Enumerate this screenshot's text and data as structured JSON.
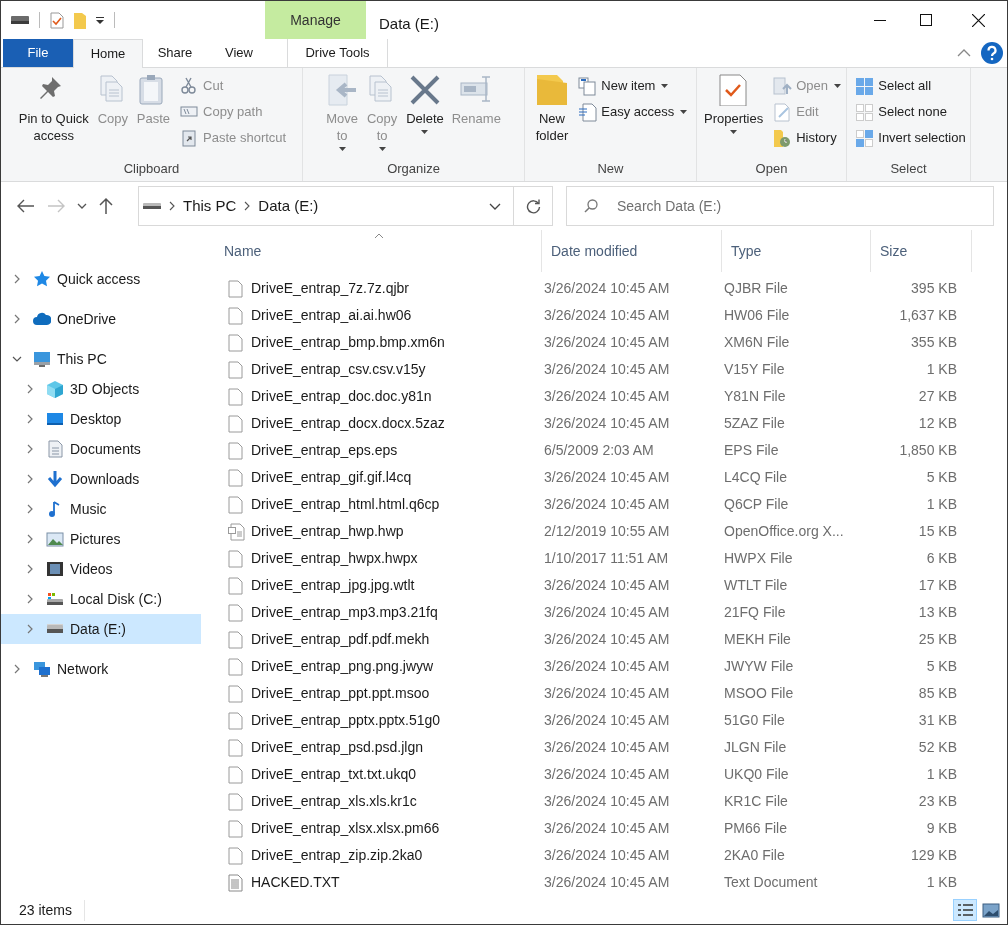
{
  "window": {
    "title": "Data (E:)"
  },
  "context_tab_group": "Manage",
  "tabs": [
    {
      "label": "File",
      "kind": "file",
      "selected": false
    },
    {
      "label": "Home",
      "kind": "tab",
      "selected": true
    },
    {
      "label": "Share",
      "kind": "tab",
      "selected": false
    },
    {
      "label": "View",
      "kind": "tab",
      "selected": false
    },
    {
      "label": "Drive Tools",
      "kind": "context",
      "selected": false
    }
  ],
  "ribbon": [
    {
      "label": "Clipboard",
      "items": [
        {
          "kind": "large",
          "label": "Pin to Quick access",
          "disabled": false,
          "dropdown": false
        },
        {
          "kind": "large",
          "label": "Copy",
          "disabled": true,
          "dropdown": false
        },
        {
          "kind": "large",
          "label": "Paste",
          "disabled": true,
          "dropdown": false
        },
        {
          "kind": "stack",
          "items": [
            {
              "label": "Cut",
              "disabled": true,
              "dropdown": false
            },
            {
              "label": "Copy path",
              "disabled": true,
              "dropdown": false
            },
            {
              "label": "Paste shortcut",
              "disabled": true,
              "dropdown": false
            }
          ]
        }
      ]
    },
    {
      "label": "Organize",
      "items": [
        {
          "kind": "large",
          "label": "Move to",
          "disabled": true,
          "dropdown": true
        },
        {
          "kind": "large",
          "label": "Copy to",
          "disabled": true,
          "dropdown": true
        },
        {
          "kind": "large",
          "label": "Delete",
          "disabled": false,
          "dropdown": true
        },
        {
          "kind": "large",
          "label": "Rename",
          "disabled": true,
          "dropdown": false
        }
      ]
    },
    {
      "label": "New",
      "items": [
        {
          "kind": "large",
          "label": "New folder",
          "disabled": false,
          "dropdown": false
        },
        {
          "kind": "stack",
          "items": [
            {
              "label": "New item",
              "disabled": false,
              "dropdown": true
            },
            {
              "label": "Easy access",
              "disabled": false,
              "dropdown": true
            }
          ]
        }
      ]
    },
    {
      "label": "Open",
      "items": [
        {
          "kind": "large",
          "label": "Properties",
          "disabled": false,
          "dropdown": true
        },
        {
          "kind": "stack",
          "items": [
            {
              "label": "Open",
              "disabled": true,
              "dropdown": true
            },
            {
              "label": "Edit",
              "disabled": true,
              "dropdown": false
            },
            {
              "label": "History",
              "disabled": false,
              "dropdown": false
            }
          ]
        }
      ]
    },
    {
      "label": "Select",
      "items": [
        {
          "kind": "stack",
          "items": [
            {
              "label": "Select all",
              "disabled": false,
              "dropdown": false
            },
            {
              "label": "Select none",
              "disabled": false,
              "dropdown": false
            },
            {
              "label": "Invert selection",
              "disabled": false,
              "dropdown": false
            }
          ]
        }
      ]
    }
  ],
  "address": {
    "crumbs": [
      "This PC",
      "Data (E:)"
    ]
  },
  "search": {
    "placeholder": "Search Data (E:)"
  },
  "navigation": [
    {
      "label": "Quick access",
      "kind": "star",
      "expanded": false,
      "selected": false
    },
    {
      "label": "OneDrive",
      "kind": "cloud",
      "expanded": false,
      "selected": false
    },
    {
      "label": "This PC",
      "kind": "pc",
      "expanded": true,
      "selected": false,
      "children": [
        {
          "label": "3D Objects",
          "kind": "cube",
          "expanded": false,
          "selected": false
        },
        {
          "label": "Desktop",
          "kind": "desktop",
          "expanded": false,
          "selected": false
        },
        {
          "label": "Documents",
          "kind": "documents",
          "expanded": false,
          "selected": false
        },
        {
          "label": "Downloads",
          "kind": "downloads",
          "expanded": false,
          "selected": false
        },
        {
          "label": "Music",
          "kind": "music",
          "expanded": false,
          "selected": false
        },
        {
          "label": "Pictures",
          "kind": "pictures",
          "expanded": false,
          "selected": false
        },
        {
          "label": "Videos",
          "kind": "videos",
          "expanded": false,
          "selected": false
        },
        {
          "label": "Local Disk (C:)",
          "kind": "system-disk",
          "expanded": false,
          "selected": false
        },
        {
          "label": "Data (E:)",
          "kind": "drive",
          "expanded": false,
          "selected": true
        }
      ]
    },
    {
      "label": "Network",
      "kind": "network",
      "expanded": false,
      "selected": false
    }
  ],
  "table": {
    "columns": [
      "Name",
      "Date modified",
      "Type",
      "Size"
    ],
    "rows": [
      {
        "kind": "blank",
        "name": "DriveE_entrap_7z.7z.qjbr",
        "date": "3/26/2024 10:45 AM",
        "type": "QJBR File",
        "size": "395 KB"
      },
      {
        "kind": "blank",
        "name": "DriveE_entrap_ai.ai.hw06",
        "date": "3/26/2024 10:45 AM",
        "type": "HW06 File",
        "size": "1,637 KB"
      },
      {
        "kind": "blank",
        "name": "DriveE_entrap_bmp.bmp.xm6n",
        "date": "3/26/2024 10:45 AM",
        "type": "XM6N File",
        "size": "355 KB"
      },
      {
        "kind": "blank",
        "name": "DriveE_entrap_csv.csv.v15y",
        "date": "3/26/2024 10:45 AM",
        "type": "V15Y File",
        "size": "1 KB"
      },
      {
        "kind": "blank",
        "name": "DriveE_entrap_doc.doc.y81n",
        "date": "3/26/2024 10:45 AM",
        "type": "Y81N File",
        "size": "27 KB"
      },
      {
        "kind": "blank",
        "name": "DriveE_entrap_docx.docx.5zaz",
        "date": "3/26/2024 10:45 AM",
        "type": "5ZAZ File",
        "size": "12 KB"
      },
      {
        "kind": "blank",
        "name": "DriveE_entrap_eps.eps",
        "date": "6/5/2009 2:03 AM",
        "type": "EPS File",
        "size": "1,850 KB"
      },
      {
        "kind": "blank",
        "name": "DriveE_entrap_gif.gif.l4cq",
        "date": "3/26/2024 10:45 AM",
        "type": "L4CQ File",
        "size": "5 KB"
      },
      {
        "kind": "blank",
        "name": "DriveE_entrap_html.html.q6cp",
        "date": "3/26/2024 10:45 AM",
        "type": "Q6CP File",
        "size": "1 KB"
      },
      {
        "kind": "document",
        "name": "DriveE_entrap_hwp.hwp",
        "date": "2/12/2019 10:55 AM",
        "type": "OpenOffice.org X...",
        "size": "15 KB"
      },
      {
        "kind": "blank",
        "name": "DriveE_entrap_hwpx.hwpx",
        "date": "1/10/2017 11:51 AM",
        "type": "HWPX File",
        "size": "6 KB"
      },
      {
        "kind": "blank",
        "name": "DriveE_entrap_jpg.jpg.wtlt",
        "date": "3/26/2024 10:45 AM",
        "type": "WTLT File",
        "size": "17 KB"
      },
      {
        "kind": "blank",
        "name": "DriveE_entrap_mp3.mp3.21fq",
        "date": "3/26/2024 10:45 AM",
        "type": "21FQ File",
        "size": "13 KB"
      },
      {
        "kind": "blank",
        "name": "DriveE_entrap_pdf.pdf.mekh",
        "date": "3/26/2024 10:45 AM",
        "type": "MEKH File",
        "size": "25 KB"
      },
      {
        "kind": "blank",
        "name": "DriveE_entrap_png.png.jwyw",
        "date": "3/26/2024 10:45 AM",
        "type": "JWYW File",
        "size": "5 KB"
      },
      {
        "kind": "blank",
        "name": "DriveE_entrap_ppt.ppt.msoo",
        "date": "3/26/2024 10:45 AM",
        "type": "MSOO File",
        "size": "85 KB"
      },
      {
        "kind": "blank",
        "name": "DriveE_entrap_pptx.pptx.51g0",
        "date": "3/26/2024 10:45 AM",
        "type": "51G0 File",
        "size": "31 KB"
      },
      {
        "kind": "blank",
        "name": "DriveE_entrap_psd.psd.jlgn",
        "date": "3/26/2024 10:45 AM",
        "type": "JLGN File",
        "size": "52 KB"
      },
      {
        "kind": "blank",
        "name": "DriveE_entrap_txt.txt.ukq0",
        "date": "3/26/2024 10:45 AM",
        "type": "UKQ0 File",
        "size": "1 KB"
      },
      {
        "kind": "blank",
        "name": "DriveE_entrap_xls.xls.kr1c",
        "date": "3/26/2024 10:45 AM",
        "type": "KR1C File",
        "size": "23 KB"
      },
      {
        "kind": "blank",
        "name": "DriveE_entrap_xlsx.xlsx.pm66",
        "date": "3/26/2024 10:45 AM",
        "type": "PM66 File",
        "size": "9 KB"
      },
      {
        "kind": "blank",
        "name": "DriveE_entrap_zip.zip.2ka0",
        "date": "3/26/2024 10:45 AM",
        "type": "2KA0 File",
        "size": "129 KB"
      },
      {
        "kind": "text",
        "name": "HACKED.TXT",
        "date": "3/26/2024 10:45 AM",
        "type": "Text Document",
        "size": "1 KB"
      }
    ]
  },
  "status_bar": {
    "count": "23 items",
    "views": [
      {
        "kind": "details",
        "selected": true
      },
      {
        "kind": "thumbnails",
        "selected": false
      }
    ]
  }
}
